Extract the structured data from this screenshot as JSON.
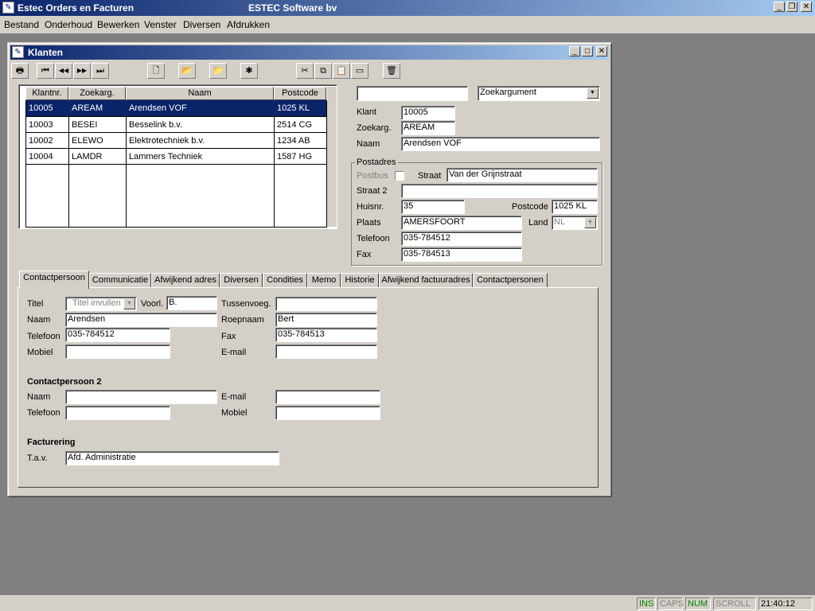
{
  "app": {
    "title": "Estec Orders en Facturen",
    "company": "ESTEC Software bv",
    "controls": {
      "minimize": "_",
      "restore": "❐",
      "close": "✕"
    }
  },
  "menu": [
    "Bestand",
    "Onderhoud",
    "Bewerken",
    "Venster",
    "Diversen",
    "Afdrukken"
  ],
  "window": {
    "title": "Klanten",
    "controls": {
      "minimize": "_",
      "maximize": "□",
      "close": "✕"
    }
  },
  "toolbar": [
    {
      "name": "print-icon",
      "glyph": "🖶"
    },
    {
      "name": "first-record-icon",
      "glyph": "⏮"
    },
    {
      "name": "prev-record-icon",
      "glyph": "◀◀"
    },
    {
      "name": "next-record-icon",
      "glyph": "▶▶"
    },
    {
      "name": "last-record-icon",
      "glyph": "⏭"
    },
    {
      "name": "new-record-icon",
      "glyph": "🗋"
    },
    {
      "name": "open-folder-icon",
      "glyph": "📂"
    },
    {
      "name": "folder-icon",
      "glyph": "📁"
    },
    {
      "name": "delete-record-icon",
      "glyph": "✱"
    },
    {
      "name": "cut-icon",
      "glyph": "✂"
    },
    {
      "name": "copy-icon",
      "glyph": "⧉"
    },
    {
      "name": "paste-icon",
      "glyph": "📋"
    },
    {
      "name": "clear-icon",
      "glyph": "▭"
    },
    {
      "name": "trash-icon",
      "glyph": "🗑"
    }
  ],
  "grid": {
    "columns": [
      "Klantnr.",
      "Zoekarg.",
      "Naam",
      "Postcode"
    ],
    "rows": [
      [
        "10005",
        "AREAM",
        "Arendsen VOF",
        "1025 KL"
      ],
      [
        "10003",
        "BESEI",
        "Besselink b.v.",
        "2514 CG"
      ],
      [
        "10002",
        "ELEWO",
        "Elektrotechniek b.v.",
        "1234 AB"
      ],
      [
        "10004",
        "LAMDR",
        "Lammers Techniek",
        "1587 HG"
      ]
    ],
    "selected_row": 0
  },
  "search": {
    "value": "",
    "argument": "Zoekargument"
  },
  "customer": {
    "klant_label": "Klant",
    "klant": "10005",
    "zoekarg_label": "Zoekarg.",
    "zoekarg": "AREAM",
    "naam_label": "Naam",
    "naam": "Arendsen VOF"
  },
  "postadres": {
    "legend": "Postadres",
    "postbus_label": "Postbus",
    "straat_label": "Straat",
    "straat": "Van der Grijnstraat",
    "straat2_label": "Straat 2",
    "straat2": "",
    "huisnr_label": "Huisnr.",
    "huisnr": "35",
    "postcode_label": "Postcode",
    "postcode": "1025 KL",
    "plaats_label": "Plaats",
    "plaats": "AMERSFOORT",
    "land_label": "Land",
    "land": "NL",
    "telefoon_label": "Telefoon",
    "telefoon": "035-784512",
    "fax_label": "Fax",
    "fax": "035-784513"
  },
  "tabs": [
    "Contactpersoon",
    "Communicatie",
    "Afwijkend adres",
    "Diversen",
    "Condities",
    "Memo",
    "Historie",
    "Afwijkend factuuradres",
    "Contactpersonen"
  ],
  "active_tab": 0,
  "contact": {
    "titel_label": "Titel",
    "titel_placeholder": "Titel invullen",
    "voorl_label": "Voorl.",
    "voorl": "B.",
    "tussenvoeg_label": "Tussenvoeg.",
    "tussenvoeg": "",
    "naam_label": "Naam",
    "naam": "Arendsen",
    "roepnaam_label": "Roepnaam",
    "roepnaam": "Bert",
    "telefoon_label": "Telefoon",
    "telefoon": "035-784512",
    "fax_label": "Fax",
    "fax": "035-784513",
    "mobiel_label": "Mobiel",
    "mobiel": "",
    "email_label": "E-mail",
    "email": ""
  },
  "contact2": {
    "heading": "Contactpersoon 2",
    "naam_label": "Naam",
    "naam": "",
    "email_label": "E-mail",
    "email": "",
    "telefoon_label": "Telefoon",
    "telefoon": "",
    "mobiel_label": "Mobiel",
    "mobiel": ""
  },
  "facturering": {
    "heading": "Facturering",
    "tav_label": "T.a.v.",
    "tav": "Afd. Administratie"
  },
  "status": {
    "ins": "INS",
    "caps": "CAPS",
    "num": "NUM",
    "scroll": "SCROLL",
    "time": "21:40:12"
  },
  "colors": {
    "titlebar_start": "#0a246a",
    "titlebar_end": "#a6caf0",
    "selection": "#0a246a",
    "face": "#d4d0c8",
    "desktop": "#808080"
  }
}
